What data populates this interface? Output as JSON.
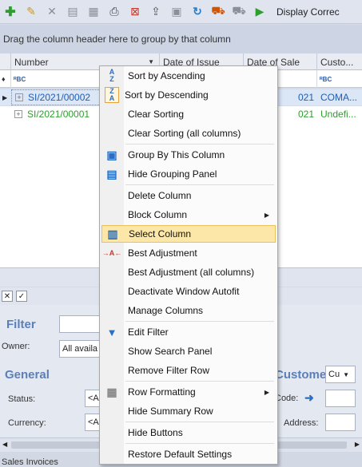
{
  "toolbar": {
    "buttons": [
      {
        "icon": "add-icon",
        "glyph": "✚",
        "color": "#2e9e2e"
      },
      {
        "icon": "edit-icon",
        "glyph": "✎",
        "color": "#c79a2a"
      },
      {
        "icon": "delete-icon",
        "glyph": "✕",
        "color": "#8a8f99"
      },
      {
        "icon": "document-icon",
        "glyph": "▤",
        "color": "#8a8f99"
      },
      {
        "icon": "print-preview-icon",
        "glyph": "▦",
        "color": "#8a8f99"
      },
      {
        "icon": "print-icon",
        "glyph": "⎙",
        "color": "#444"
      },
      {
        "icon": "cancel-icon",
        "glyph": "⊠",
        "color": "#c0392b"
      },
      {
        "icon": "export-icon",
        "glyph": "⇪",
        "color": "#555"
      },
      {
        "icon": "report-icon",
        "glyph": "▣",
        "color": "#8a8f99"
      },
      {
        "icon": "refresh-icon",
        "glyph": "↻",
        "color": "#2a7fc9"
      },
      {
        "icon": "shipping-icon",
        "glyph": "⛟",
        "color": "#d35400"
      },
      {
        "icon": "delivery-icon",
        "glyph": "⛟",
        "color": "#8a8f99"
      },
      {
        "icon": "run-icon",
        "glyph": "▶",
        "color": "#2e9e2e"
      }
    ],
    "display_label": "Display Correc"
  },
  "grouping_panel": {
    "hint": "Drag the column header here to group by that column"
  },
  "grid": {
    "columns": [
      {
        "label": "Number"
      },
      {
        "label": "Date of Issue"
      },
      {
        "label": "Date of Sale"
      },
      {
        "label": "Custo..."
      }
    ],
    "filter_badge": "ᴿBC",
    "rows": [
      {
        "number": "SI/2021/00002",
        "date_of_sale": "021",
        "customer": "COMA..."
      },
      {
        "number": "SI/2021/00001",
        "date_of_sale": "021",
        "customer": "Undefi..."
      }
    ]
  },
  "lower_panel": {
    "filter_title": "Filter",
    "owner_label": "Owner:",
    "owner_value": "All availa",
    "general_title": "General",
    "status_label": "Status:",
    "status_value": "<A",
    "currency_label": "Currency:",
    "currency_value": "<A",
    "customer_title": "Custome",
    "customer_select": "Cu",
    "code_label": "Code:",
    "address_label": "Address:"
  },
  "status_bar": {
    "text": "Sales Invoices"
  },
  "context_menu": {
    "items": [
      {
        "label": "Sort by Ascending",
        "icon": "sort-ascending-icon",
        "glyph": "A↓Z"
      },
      {
        "label": "Sort by Descending",
        "icon": "sort-descending-icon",
        "glyph": "Z↓A"
      },
      {
        "label": "Clear Sorting",
        "icon": "",
        "glyph": ""
      },
      {
        "label": "Clear Sorting (all columns)",
        "icon": "",
        "glyph": ""
      },
      {
        "label": "Group By This Column",
        "icon": "group-by-icon",
        "glyph": "▣"
      },
      {
        "label": "Hide Grouping Panel",
        "icon": "grouping-panel-icon",
        "glyph": "▤"
      },
      {
        "label": "Delete Column",
        "icon": "",
        "glyph": ""
      },
      {
        "label": "Block Column",
        "icon": "",
        "glyph": "",
        "submenu": true
      },
      {
        "label": "Select Column",
        "icon": "select-column-icon",
        "glyph": "▥",
        "highlighted": true
      },
      {
        "label": "Best Adjustment",
        "icon": "best-adjustment-icon",
        "glyph": "→A←"
      },
      {
        "label": "Best Adjustment (all columns)",
        "icon": "",
        "glyph": ""
      },
      {
        "label": "Deactivate Window Autofit",
        "icon": "",
        "glyph": ""
      },
      {
        "label": "Manage Columns",
        "icon": "",
        "glyph": ""
      },
      {
        "label": "Edit Filter",
        "icon": "filter-icon",
        "glyph": "▼"
      },
      {
        "label": "Show Search Panel",
        "icon": "",
        "glyph": ""
      },
      {
        "label": "Remove Filter Row",
        "icon": "",
        "glyph": ""
      },
      {
        "label": "Row Formatting",
        "icon": "row-formatting-icon",
        "glyph": "▦",
        "submenu": true
      },
      {
        "label": "Hide Summary Row",
        "icon": "",
        "glyph": ""
      },
      {
        "label": "Hide Buttons",
        "icon": "",
        "glyph": ""
      },
      {
        "label": "Restore Default Settings",
        "icon": "",
        "glyph": ""
      }
    ]
  },
  "colors": {
    "accent_blue": "#2d5aa0",
    "highlight_bg": "#fde7a8",
    "section_title": "#5b7fb8",
    "row_text_blue": "#1f5fb0",
    "row_text_green": "#2e9e2e"
  }
}
